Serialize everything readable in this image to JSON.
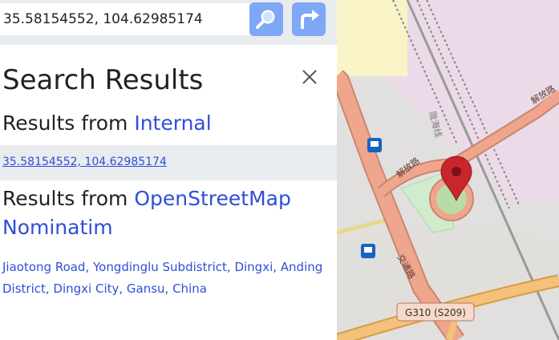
{
  "search": {
    "value": "35.58154552, 104.62985174",
    "placeholder": ""
  },
  "icons": {
    "search": "magnifier-icon",
    "directions": "directions-arrow-icon",
    "close": "close-icon",
    "marker": "map-marker-icon",
    "bus": "bus-stop-icon"
  },
  "panel": {
    "title": "Search Results",
    "internal": {
      "prefix": "Results from ",
      "source": "Internal",
      "result": "35.58154552, 104.62985174"
    },
    "osm": {
      "prefix": "Results from ",
      "source": "OpenStreetMap Nominatim",
      "result": "Jiaotong Road, Yongdinglu Subdistrict, Dingxi, Anding District, Dingxi City, Gansu, China"
    }
  },
  "map": {
    "road_shield": "G310 (S209)",
    "label_jiefang_road": "解放路",
    "label_jiefang_road_ne": "解放路",
    "label_jiaotong_road": "交通路",
    "label_longhai_line": "陇海线"
  },
  "colors": {
    "accent": "#2e4fd7",
    "button": "#7ea7f5",
    "panel_gray": "#e9ecef",
    "marker": "#c8262c"
  }
}
